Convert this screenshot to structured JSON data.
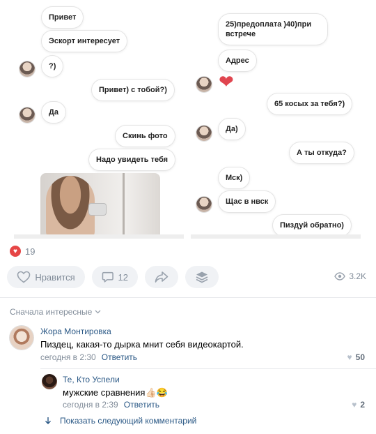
{
  "post_image": {
    "left_chat": [
      {
        "text": "Привет",
        "side": "in"
      },
      {
        "text": "Эскорт интересует",
        "side": "in"
      },
      {
        "text": "?)",
        "side": "in"
      },
      {
        "text": "Привет) с тобой?)",
        "side": "out"
      },
      {
        "text": "Да",
        "side": "in"
      },
      {
        "text": "Скинь фото",
        "side": "out"
      },
      {
        "text": "Надо увидеть тебя",
        "side": "out"
      }
    ],
    "right_chat": [
      {
        "text": "25)предоплата )40)при встрече",
        "side": "in"
      },
      {
        "text": "Адрес",
        "side": "in"
      },
      {
        "text": "❤",
        "side": "in"
      },
      {
        "text": "65 косых за тебя?)",
        "side": "out"
      },
      {
        "text": "Да)",
        "side": "in"
      },
      {
        "text": "А ты откуда?",
        "side": "out"
      },
      {
        "text": "Мск)",
        "side": "in"
      },
      {
        "text": "Щас в нвск",
        "side": "in"
      },
      {
        "text": "Пиздуй обратно)",
        "side": "out"
      }
    ]
  },
  "reactions": {
    "count": "19",
    "icon": "heart-icon",
    "color": "#e64646"
  },
  "actions": {
    "like_label": "Нравится",
    "comments_count": "12",
    "views_count": "3.2K"
  },
  "comments": {
    "sort_label": "Сначала интересные",
    "items": [
      {
        "author": "Жора Монтировка",
        "text": "Пиздец, какая-то дырка мнит себя видеокартой.",
        "time": "сегодня в 2:30",
        "reply_label": "Ответить",
        "likes": "50"
      },
      {
        "author": "Те, Кто Успели",
        "text": "мужские сравнения👍🏻😂",
        "time": "сегодня в 2:39",
        "reply_label": "Ответить",
        "likes": "2"
      }
    ],
    "show_next_label": "Показать следующий комментарий"
  },
  "colors": {
    "accent": "#2a5885",
    "muted": "#818c99",
    "button_bg": "#f0f2f5"
  }
}
